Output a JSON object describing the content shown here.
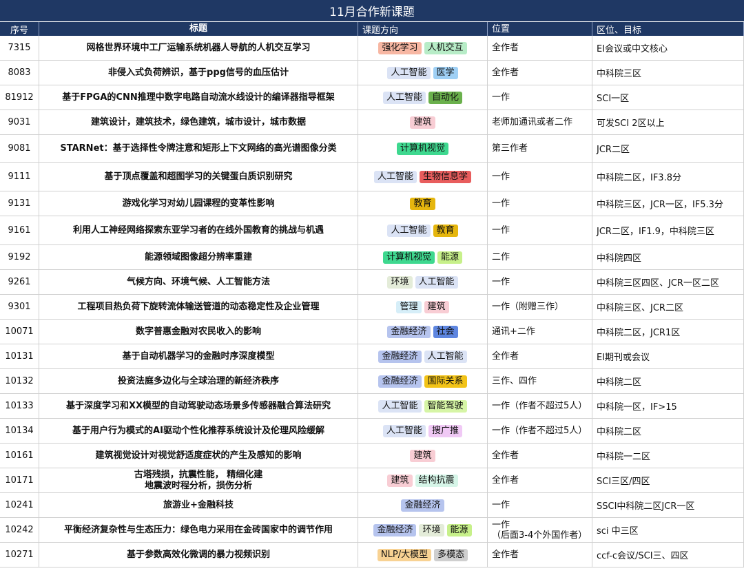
{
  "title": "11月合作新课题",
  "headers": [
    "序号",
    "标题",
    "课题方向",
    "位置",
    "区位、目标"
  ],
  "tag_colors": {
    "强化学习": "#f7b7a3",
    "人机交互": "#b7ecc7",
    "人工智能": "#dbe3f5",
    "医学": "#9fd0f5",
    "自动化": "#6ab04c",
    "建筑": "#f8cdd4",
    "计算机视觉": "#3ed88f",
    "生物信息学": "#e85d5d",
    "教育": "#e5b60e",
    "能源": "#c7f08a",
    "环境": "#e4ecd9",
    "管理": "#d6eef8",
    "金融经济": "#b6c4ee",
    "社会": "#5e86e0",
    "国际关系": "#f2c318",
    "智能驾驶": "#d6f5a6",
    "搜广推": "#f0c9f5",
    "结构抗震": "#d6f5e8",
    "NLP/大模型": "#f8d293",
    "多模态": "#cfcfcf"
  },
  "rows": [
    {
      "id": "7315",
      "title": "网格世界环境中工厂运输系统机器人导航的人机交互学习",
      "tags": [
        "强化学习",
        "人机交互"
      ],
      "position": "全作者",
      "target": "EI会议或中文核心"
    },
    {
      "id": "8083",
      "title": "非侵入式负荷辨识，基于ppg信号的血压估计",
      "tags": [
        "人工智能",
        "医学"
      ],
      "position": "全作者",
      "target": "中科院三区"
    },
    {
      "id": "81912",
      "title": "基于FPGA的CNN推理中数字电路自动流水线设计的编译器指导框架",
      "tags": [
        "人工智能",
        "自动化"
      ],
      "position": "一作",
      "target": "SCI一区"
    },
    {
      "id": "9031",
      "title": "建筑设计，建筑技术，绿色建筑，城市设计，城市数据",
      "tags": [
        "建筑"
      ],
      "position": "老师加通讯或者二作",
      "target": "可发SCI 2区以上"
    },
    {
      "id": "9081",
      "title": "STARNet：基于选择性令牌注意和矩形上下文网络的高光谱图像分类",
      "tags": [
        "计算机视觉"
      ],
      "position": "第三作者",
      "target": "JCR二区"
    },
    {
      "id": "9111",
      "title": "基于顶点覆盖和超图学习的关键蛋白质识别研究",
      "tags": [
        "人工智能",
        "生物信息学"
      ],
      "position": "一作",
      "target": "中科院二区，IF3.8分"
    },
    {
      "id": "9131",
      "title": "游戏化学习对幼儿园课程的变革性影响",
      "tags": [
        "教育"
      ],
      "position": "一作",
      "target": "中科院三区，JCR一区，IF5.3分"
    },
    {
      "id": "9161",
      "title": "利用人工神经网络探索东亚学习者的在线外国教育的挑战与机遇",
      "tags": [
        "人工智能",
        "教育"
      ],
      "position": "一作",
      "target": "JCR二区，IF1.9，中科院三区"
    },
    {
      "id": "9192",
      "title": "能源领域图像超分辨率重建",
      "tags": [
        "计算机视觉",
        "能源"
      ],
      "position": "二作",
      "target": "中科院四区"
    },
    {
      "id": "9261",
      "title": "气候方向、环境气候、人工智能方法",
      "tags": [
        "环境",
        "人工智能"
      ],
      "position": "一作",
      "target": "中科院三区四区、JCR一区二区"
    },
    {
      "id": "9301",
      "title": "工程项目热负荷下旋转流体输送管道的动态稳定性及企业管理",
      "tags": [
        "管理",
        "建筑"
      ],
      "position": "一作（附赠三作）",
      "target": "中科院三区、JCR二区"
    },
    {
      "id": "10071",
      "title": "数字普惠金融对农民收入的影响",
      "tags": [
        "金融经济",
        "社会"
      ],
      "position": "通讯+二作",
      "target": "中科院二区，JCR1区"
    },
    {
      "id": "10131",
      "title": "基于自动机器学习的金融时序深度模型",
      "tags": [
        "金融经济",
        "人工智能"
      ],
      "position": "全作者",
      "target": "EI期刊或会议"
    },
    {
      "id": "10132",
      "title": "投资法庭多边化与全球治理的新经济秩序",
      "tags": [
        "金融经济",
        "国际关系"
      ],
      "position": "三作、四作",
      "target": "中科院二区"
    },
    {
      "id": "10133",
      "title": "基于深度学习和XX模型的自动驾驶动态场景多传感器融合算法研究",
      "tags": [
        "人工智能",
        "智能驾驶"
      ],
      "position": "一作（作者不超过5人）",
      "target": "中科院一区，IF>15"
    },
    {
      "id": "10134",
      "title": "基于用户行为模式的AI驱动个性化推荐系统设计及伦理风险缓解",
      "tags": [
        "人工智能",
        "搜广推"
      ],
      "position": "一作（作者不超过5人）",
      "target": "中科院二区"
    },
    {
      "id": "10161",
      "title": "建筑视觉设计对视觉舒适度症状的产生及感知的影响",
      "tags": [
        "建筑"
      ],
      "position": "全作者",
      "target": "中科院一二区"
    },
    {
      "id": "10171",
      "title": "古塔残损，抗震性能， 精细化建\n地震波时程分析，损伤分析",
      "tags": [
        "建筑",
        "结构抗震"
      ],
      "position": "全作者",
      "target": "SCI三区/四区"
    },
    {
      "id": "10241",
      "title": "旅游业+金融科技",
      "tags": [
        "金融经济"
      ],
      "position": "一作",
      "target": "SSCI中科院二区JCR一区"
    },
    {
      "id": "10242",
      "title": "平衡经济复杂性与生态压力：绿色电力采用在金砖国家中的调节作用",
      "tags": [
        "金融经济",
        "环境",
        "能源"
      ],
      "position": "一作\n（后面3-4个外国作者）",
      "target": "sci 中三区"
    },
    {
      "id": "10271",
      "title": "基于参数高效化微调的暴力视频识别",
      "tags": [
        "NLP/大模型",
        "多模态"
      ],
      "position": "全作者",
      "target": "ccf-c会议/SCI三、四区"
    }
  ]
}
